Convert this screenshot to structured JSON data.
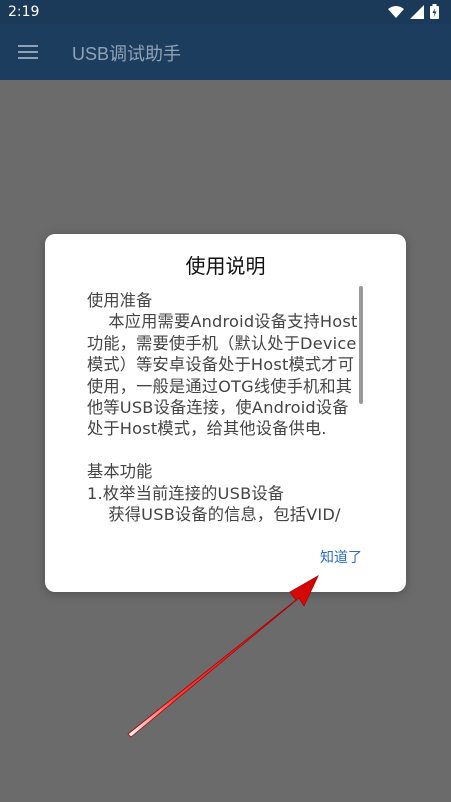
{
  "status": {
    "time": "2:19",
    "icons": [
      "wifi-icon",
      "signal-icon",
      "battery-icon"
    ]
  },
  "app": {
    "title": "USB调试助手",
    "menu_icon": "menu-icon"
  },
  "dialog": {
    "title": "使用说明",
    "body": "使用准备\n    本应用需要Android设备支持Host功能，需要使手机（默认处于Device模式）等安卓设备处于Host模式才可使用，一般是通过OTG线使手机和其他等USB设备连接，使Android设备处于Host模式，给其他设备供电.\n\n基本功能\n1.枚举当前连接的USB设备\n    获得USB设备的信息，包括VID/",
    "ok_button": "知道了"
  },
  "colors": {
    "status_bar": "#1b3a5a",
    "app_bar": "#1d3d5e",
    "overlay": "#6b6b6b",
    "accent": "#2a6fc0",
    "arrow": "#e00000"
  }
}
